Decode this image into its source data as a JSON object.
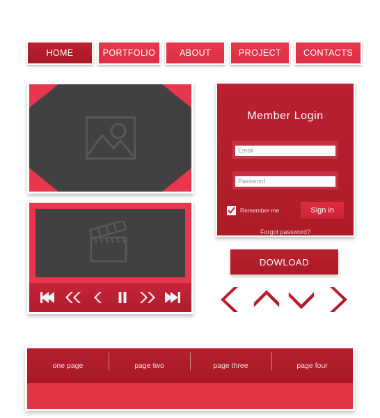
{
  "navbar": {
    "items": [
      {
        "label": "HOME",
        "active": true
      },
      {
        "label": "PORTFOLIO",
        "active": false
      },
      {
        "label": "ABOUT",
        "active": false
      },
      {
        "label": "PROJECT",
        "active": false
      },
      {
        "label": "CONTACTS",
        "active": false
      }
    ]
  },
  "image_box": {
    "icon": "photo-placeholder-icon"
  },
  "video_box": {
    "icon": "clapperboard-icon",
    "controls": [
      {
        "name": "skip-to-start-icon",
        "label": "Skip to start"
      },
      {
        "name": "rewind-icon",
        "label": "Rewind"
      },
      {
        "name": "previous-icon",
        "label": "Previous"
      },
      {
        "name": "pause-icon",
        "label": "Pause"
      },
      {
        "name": "next-icon",
        "label": "Next"
      },
      {
        "name": "fast-forward-icon",
        "label": "Fast forward"
      },
      {
        "name": "skip-to-end-icon",
        "label": "Skip to end"
      }
    ]
  },
  "login": {
    "title": "Member  Login",
    "email_placeholder": "Email",
    "email_value": "",
    "password_placeholder": "Password",
    "password_value": "",
    "remember_label": "Remember me",
    "remember_checked": true,
    "signin_label": "Sign in",
    "forgot_label": "Forgot password?"
  },
  "download": {
    "label": "DOWLOAD"
  },
  "arrows": [
    {
      "name": "chevron-left-icon",
      "direction": "left"
    },
    {
      "name": "chevron-up-icon",
      "direction": "up"
    },
    {
      "name": "chevron-down-icon",
      "direction": "down"
    },
    {
      "name": "chevron-right-icon",
      "direction": "right"
    }
  ],
  "pagination": {
    "items": [
      {
        "label": "one page"
      },
      {
        "label": "page two"
      },
      {
        "label": "page three"
      },
      {
        "label": "page four"
      }
    ]
  },
  "colors": {
    "brand_red": "#e8374d",
    "dark_red": "#b51f2b",
    "deep_red": "#a61a26",
    "light_red": "#e23644",
    "placeholder_gray": "#414141",
    "white": "#ffffff"
  }
}
